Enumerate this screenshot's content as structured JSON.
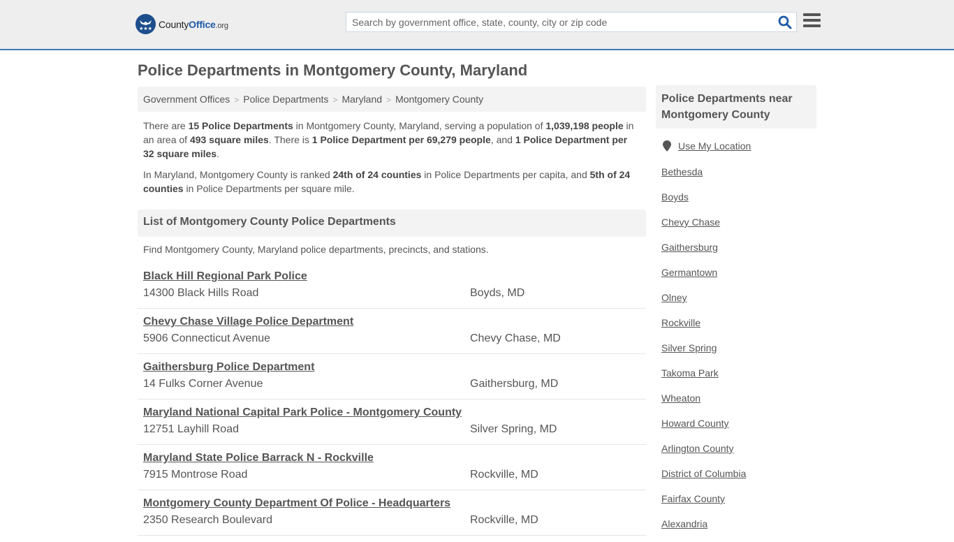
{
  "header": {
    "logo": {
      "brand_part1": "County",
      "brand_part2": "Office",
      "brand_suffix": ".org",
      "icon": "eagle-stars-icon"
    },
    "search": {
      "placeholder": "Search by government office, state, county, city or zip code",
      "value": "",
      "icon": "search-icon"
    },
    "menu_icon": "hamburger-menu-icon",
    "colors": {
      "accent": "#3c7ab4",
      "logo_blue": "#1d4e8c",
      "search_icon": "#1d5aa6"
    }
  },
  "page": {
    "title": "Police Departments in Montgomery County, Maryland",
    "breadcrumb": [
      "Government Offices",
      "Police Departments",
      "Maryland",
      "Montgomery County"
    ],
    "intro": {
      "p1": {
        "t1": "There are ",
        "b1": "15 Police Departments",
        "t2": " in Montgomery County, Maryland, serving a population of ",
        "b2": "1,039,198 people",
        "t3": " in an area of ",
        "b3": "493 square miles",
        "t4": ". There is ",
        "b4": "1 Police Department per 69,279 people",
        "t5": ", and ",
        "b5": "1 Police Department per 32 square miles",
        "t6": "."
      },
      "p2": {
        "t1": "In Maryland, Montgomery County is ranked ",
        "b1": "24th of 24 counties",
        "t2": " in Police Departments per capita, and ",
        "b2": "5th of 24 counties",
        "t3": " in Police Departments per square mile."
      }
    },
    "list_header": "List of Montgomery County Police Departments",
    "list_description": "Find Montgomery County, Maryland police departments, precincts, and stations.",
    "departments": [
      {
        "name": "Black Hill Regional Park Police",
        "address": "14300 Black Hills Road",
        "city": "Boyds, MD"
      },
      {
        "name": "Chevy Chase Village Police Department",
        "address": "5906 Connecticut Avenue",
        "city": "Chevy Chase, MD"
      },
      {
        "name": "Gaithersburg Police Department",
        "address": "14 Fulks Corner Avenue",
        "city": "Gaithersburg, MD"
      },
      {
        "name": "Maryland National Capital Park Police - Montgomery County",
        "address": "12751 Layhill Road",
        "city": "Silver Spring, MD"
      },
      {
        "name": "Maryland State Police Barrack N - Rockville",
        "address": "7915 Montrose Road",
        "city": "Rockville, MD"
      },
      {
        "name": "Montgomery County Department Of Police - Headquarters",
        "address": "2350 Research Boulevard",
        "city": "Rockville, MD"
      }
    ]
  },
  "sidebar": {
    "header": "Police Departments near Montgomery County",
    "use_location": {
      "label": "Use My Location",
      "icon": "map-pin-icon"
    },
    "links": [
      "Bethesda",
      "Boyds",
      "Chevy Chase",
      "Gaithersburg",
      "Germantown",
      "Olney",
      "Rockville",
      "Silver Spring",
      "Takoma Park",
      "Wheaton",
      "Howard County",
      "Arlington County",
      "District of Columbia",
      "Fairfax County",
      "Alexandria"
    ]
  }
}
